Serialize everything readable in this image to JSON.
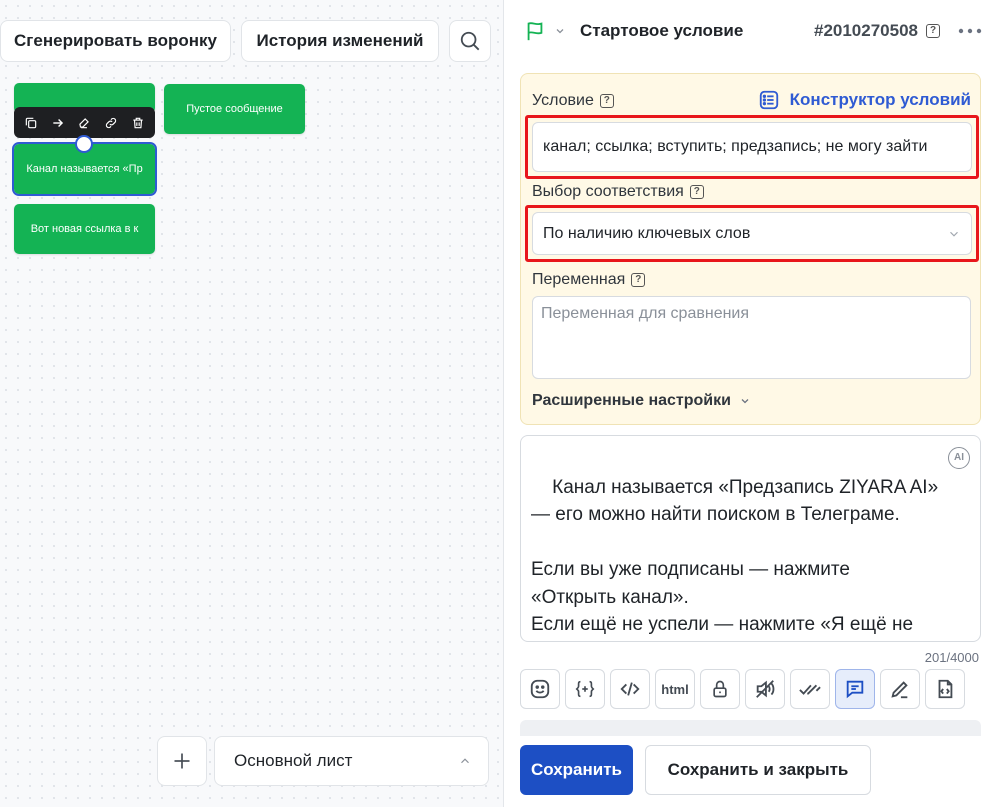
{
  "canvas": {
    "generate_funnel_label": "Сгенерировать воронку",
    "history_label": "История изменений",
    "nodes": [
      {
        "label": ""
      },
      {
        "label": "Пустое сообщение"
      },
      {
        "label": "Канал называется «Пр"
      },
      {
        "label": "Вот новая ссылка в к"
      }
    ],
    "sheet_label": "Основной лист"
  },
  "panel": {
    "title": "Стартовое условие",
    "id": "#2010270508",
    "condition": {
      "label": "Условие",
      "constructor_label": "Конструктор условий",
      "value": "канал; ссылка; вступить; предзапись; не могу зайти"
    },
    "match": {
      "label": "Выбор соответствия",
      "selected": "По наличию ключевых слов"
    },
    "variable": {
      "label": "Переменная",
      "placeholder": "Переменная для сравнения"
    },
    "advanced_label": "Расширенные настройки",
    "message_text": "Канал называется «Предзапись ZIYARA AI» — его можно найти поиском в Телеграме.\n\nЕсли вы уже подписаны — нажмите «Открыть канал».\nЕсли ещё не успели — нажмите «Я ещё не подписался», пришлю новую ссылку.",
    "ai_badge": "AI",
    "char_count": "201/4000",
    "tool_html_label": "html",
    "save_label": "Сохранить",
    "save_close_label": "Сохранить и закрыть"
  },
  "colors": {
    "accent": "#1d4fc4",
    "node_green": "#14b354",
    "highlight_red": "#e8161b",
    "condition_bg": "#fff9e6"
  }
}
